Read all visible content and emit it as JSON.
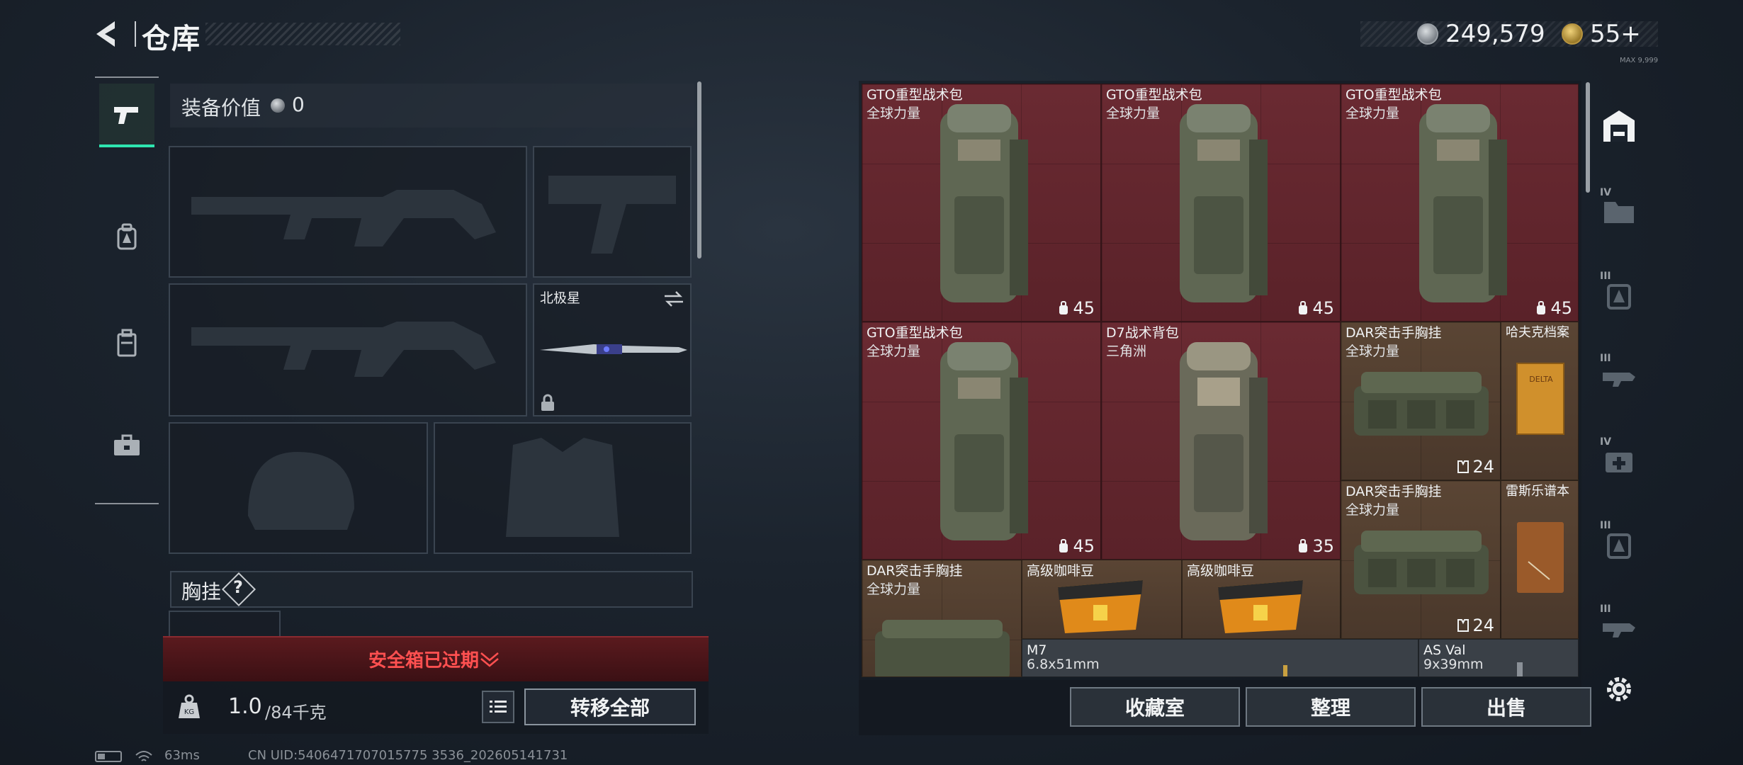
{
  "header": {
    "title": "仓库",
    "currency_silver": "249,579",
    "currency_gold": "55+",
    "tiny_note": "MAX 9,999"
  },
  "left_nav": {
    "items": [
      {
        "name": "pistol-icon",
        "active": true
      },
      {
        "name": "backpack-icon",
        "active": false
      },
      {
        "name": "vest-icon",
        "active": false
      },
      {
        "name": "toolbox-icon",
        "active": false
      }
    ]
  },
  "equipment": {
    "value_label": "装备价值",
    "value": "0",
    "melee_name": "北极星",
    "chest_label": "胸挂",
    "chest_help": "?"
  },
  "safebox": {
    "expired_text": "安全箱已过期"
  },
  "footer_left": {
    "weight_value": "1.0",
    "weight_capacity": "/84千克",
    "transfer_all": "转移全部"
  },
  "warehouse": {
    "items": [
      {
        "name": "GTO重型战术包",
        "tag": "全球力量",
        "badge": "45",
        "badge_icon": "capacity-icon"
      },
      {
        "name": "GTO重型战术包",
        "tag": "全球力量",
        "badge": "45",
        "badge_icon": "capacity-icon"
      },
      {
        "name": "GTO重型战术包",
        "tag": "全球力量",
        "badge": "45",
        "badge_icon": "capacity-icon"
      },
      {
        "name": "GTO重型战术包",
        "tag": "全球力量",
        "badge": "45",
        "badge_icon": "capacity-icon"
      },
      {
        "name": "D7战术背包",
        "tag": "三角洲",
        "badge": "35",
        "badge_icon": "capacity-icon"
      },
      {
        "name": "DAR突击手胸挂",
        "tag": "全球力量",
        "badge": "24",
        "badge_icon": "vest-slot-icon"
      },
      {
        "name": "哈夫克档案",
        "tag": "",
        "badge": ""
      },
      {
        "name": "DAR突击手胸挂",
        "tag": "全球力量",
        "badge": "24",
        "badge_icon": "vest-slot-icon"
      },
      {
        "name": "雷斯乐谱本",
        "tag": "",
        "badge": ""
      },
      {
        "name": "DAR突击手胸挂",
        "tag": "全球力量",
        "badge": ""
      },
      {
        "name": "高级咖啡豆",
        "tag": "",
        "badge": ""
      },
      {
        "name": "高级咖啡豆",
        "tag": "",
        "badge": ""
      },
      {
        "name": "M7",
        "tag": "6.8x51mm",
        "badge": ""
      },
      {
        "name": "AS Val",
        "tag": "9x39mm",
        "badge": ""
      }
    ],
    "buttons": {
      "collection": "收藏室",
      "organize": "整理",
      "sell": "出售"
    }
  },
  "side_tabs": [
    {
      "label": "",
      "icon": "storage-icon",
      "active": true
    },
    {
      "label": "IV",
      "icon": "folder-icon"
    },
    {
      "label": "III",
      "icon": "backpack-icon"
    },
    {
      "label": "III",
      "icon": "weapon-icon"
    },
    {
      "label": "IV",
      "icon": "medkit-icon"
    },
    {
      "label": "III",
      "icon": "backpack-icon"
    },
    {
      "label": "III",
      "icon": "weapon-icon"
    }
  ],
  "status_bar": {
    "ping": "63ms",
    "uid": "CN UID:5406471707015775 3536_202605141731"
  },
  "colors": {
    "accent": "#2ee6b0",
    "danger": "#ff5050",
    "item_red": "#5a2229",
    "item_brown": "#4a382b"
  }
}
